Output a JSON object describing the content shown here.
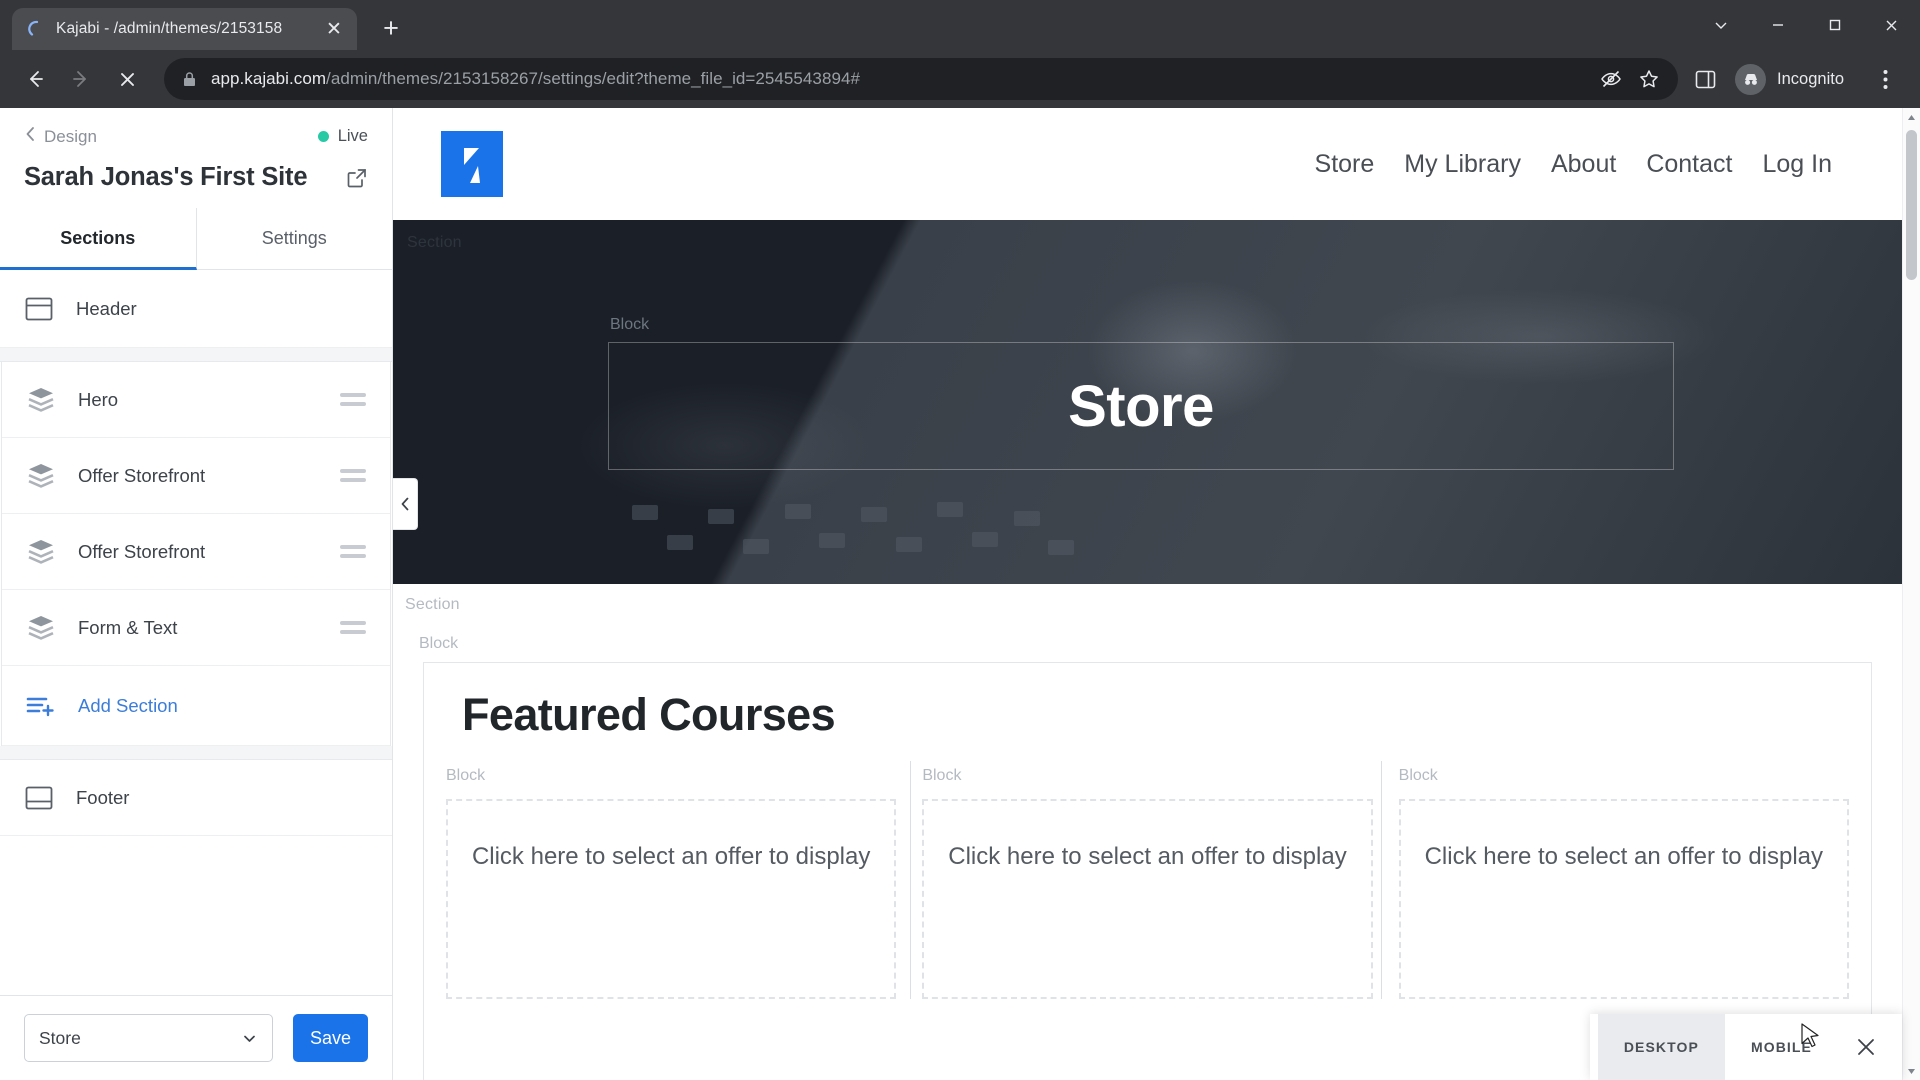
{
  "browser": {
    "tab": {
      "title": "Kajabi - /admin/themes/2153158",
      "close_label": "✕",
      "spinner_icon": "loading-spinner-icon"
    },
    "new_tab_label": "+",
    "window_controls": {
      "minimize": "minimize-icon",
      "maximize": "maximize-icon",
      "close": "close-icon",
      "chevron": "chevron-down-icon"
    },
    "nav": {
      "back": "back-arrow-icon",
      "forward": "forward-arrow-icon",
      "stop": "stop-loading-icon"
    },
    "omnibox": {
      "lock_icon": "lock-icon",
      "url_domain": "app.kajabi.com",
      "url_path": "/admin/themes/2153158267/settings/edit?theme_file_id=2545543894#",
      "tracking_protection_icon": "eye-slash-icon",
      "bookmark_icon": "star-icon",
      "side_panel_icon": "side-panel-icon"
    },
    "profile": {
      "label": "Incognito",
      "avatar_icon": "incognito-hat-icon"
    },
    "menu_icon": "three-dots-vertical-icon"
  },
  "editor": {
    "breadcrumb": {
      "label": "Design",
      "icon": "chevron-left-icon"
    },
    "status": {
      "label": "Live",
      "color": "#28c9a5"
    },
    "site_title": "Sarah Jonas's First Site",
    "external_link_icon": "external-link-icon",
    "tabs": [
      {
        "label": "Sections",
        "active": true
      },
      {
        "label": "Settings",
        "active": false
      }
    ],
    "sections": [
      {
        "label": "Header",
        "icon": "header-block-icon",
        "draggable": false
      },
      {
        "label": "Hero",
        "icon": "layers-icon",
        "draggable": true
      },
      {
        "label": "Offer Storefront",
        "icon": "layers-icon",
        "draggable": true
      },
      {
        "label": "Offer Storefront",
        "icon": "layers-icon",
        "draggable": true
      },
      {
        "label": "Form & Text",
        "icon": "layers-icon",
        "draggable": true
      }
    ],
    "add_section": {
      "label": "Add Section",
      "icon": "list-plus-icon",
      "color": "#3b7dd8"
    },
    "footer_section": {
      "label": "Footer",
      "icon": "footer-block-icon"
    },
    "footer_bar": {
      "page_select_value": "Store",
      "page_select_icon": "chevron-down-icon",
      "save_label": "Save",
      "save_color": "#1a73e8"
    },
    "collapse_icon": "chevron-left-icon"
  },
  "preview": {
    "logo_icon": "kajabi-k-logo",
    "logo_color": "#1a73e8",
    "nav_links": [
      "Store",
      "My Library",
      "About",
      "Contact",
      "Log In"
    ],
    "hero": {
      "section_tag": "Section",
      "block_tag": "Block",
      "title": "Store"
    },
    "courses": {
      "section_tag": "Section",
      "block_tag": "Block",
      "title": "Featured Courses",
      "cards": [
        {
          "block_tag": "Block",
          "text": "Click here to select an offer to display"
        },
        {
          "block_tag": "Block",
          "text": "Click here to select an offer to display"
        },
        {
          "block_tag": "Block",
          "text": "Click here to select an offer to display"
        }
      ]
    },
    "device_bar": {
      "desktop_label": "DESKTOP",
      "mobile_label": "MOBILE",
      "active": "DESKTOP",
      "close_icon": "close-icon"
    },
    "scrollbar": {
      "up_icon": "scroll-up-arrow",
      "down_icon": "scroll-down-arrow"
    }
  }
}
